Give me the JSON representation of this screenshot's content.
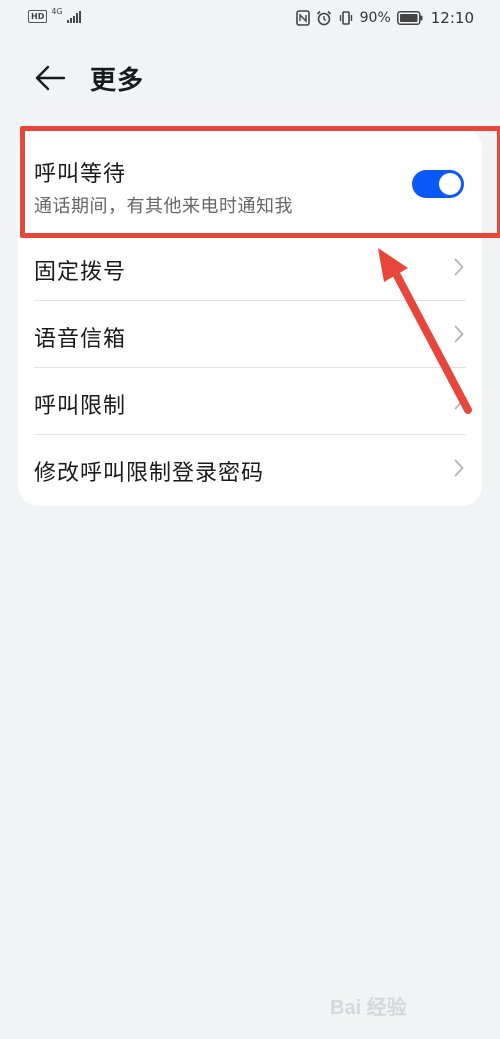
{
  "status_bar": {
    "hd_label": "HD",
    "network_type": "4G",
    "battery_percent": "90%",
    "time": "12:10",
    "icons": [
      "hd-icon",
      "signal-icon",
      "nfc-icon",
      "alarm-icon",
      "vibrate-icon",
      "battery-icon"
    ]
  },
  "header": {
    "title": "更多",
    "back_icon": "arrow-left-icon"
  },
  "settings": {
    "call_waiting": {
      "label": "呼叫等待",
      "description": "通话期间，有其他来电时通知我",
      "enabled": true
    },
    "items": [
      {
        "label": "固定拨号"
      },
      {
        "label": "语音信箱"
      },
      {
        "label": "呼叫限制"
      },
      {
        "label": "修改呼叫限制登录密码"
      }
    ]
  },
  "colors": {
    "toggle_on": "#0a59f7",
    "highlight": "#e8463a",
    "background": "#f1f3f5"
  },
  "watermark": {
    "text": "Bai 经验",
    "url": "jingyan.baidu.com"
  }
}
